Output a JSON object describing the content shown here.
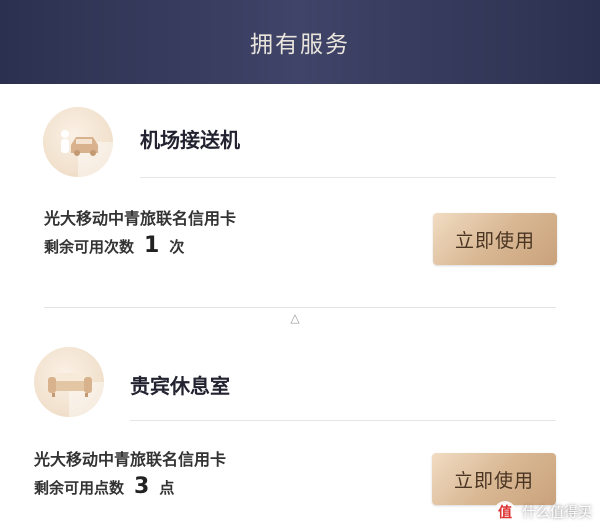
{
  "header": {
    "title": "拥有服务"
  },
  "services": [
    {
      "icon": "car-person-icon",
      "title": "机场接送机",
      "card_name": "光大移动中青旅联名信用卡",
      "remaining_prefix": "剩余可用次数",
      "remaining_count": "1",
      "remaining_unit": "次",
      "button_label": "立即使用"
    },
    {
      "icon": "sofa-icon",
      "title": "贵宾休息室",
      "card_name": "光大移动中青旅联名信用卡",
      "remaining_prefix": "剩余可用点数",
      "remaining_count": "3",
      "remaining_unit": "点",
      "button_label": "立即使用"
    }
  ],
  "collapse_toggle": "△",
  "watermark": {
    "logo": "值",
    "text": "什么值得买"
  },
  "colors": {
    "header_bg": "#2c3050",
    "button_gold": "#d9b894",
    "icon_bg": "#f2e2cf"
  }
}
